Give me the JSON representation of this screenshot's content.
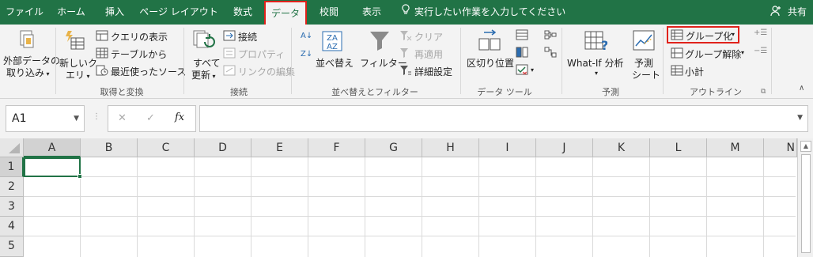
{
  "tabs": [
    "ファイル",
    "ホーム",
    "挿入",
    "ページ レイアウト",
    "数式",
    "データ",
    "校閲",
    "表示"
  ],
  "active_tab": "データ",
  "tell_me": "実行したい作業を入力してください",
  "share": "共有",
  "ribbon": {
    "external_data": {
      "l1": "外部データの",
      "l2": "取り込み"
    },
    "new_query": {
      "l1": "新しいク",
      "l2": "エリ"
    },
    "show_queries": "クエリの表示",
    "from_table": "テーブルから",
    "recent_sources": "最近使ったソース",
    "group_get_transform": "取得と変換",
    "refresh_all": {
      "l1": "すべて",
      "l2": "更新"
    },
    "connections": "接続",
    "properties": "プロパティ",
    "edit_links": "リンクの編集",
    "group_connections": "接続",
    "sort": "並べ替え",
    "filter": "フィルター",
    "clear": "クリア",
    "reapply": "再適用",
    "advanced": "詳細設定",
    "group_sort_filter": "並べ替えとフィルター",
    "text_to_columns": "区切り位置",
    "group_data_tools": "データ ツール",
    "what_if": "What-If 分析",
    "forecast_sheet": {
      "l1": "予測",
      "l2": "シート"
    },
    "group_forecast": "予測",
    "group_btn": "グループ化",
    "ungroup": "グループ解除",
    "subtotal": "小計",
    "group_outline": "アウトライン"
  },
  "formula_bar": {
    "name_box": "A1",
    "fx": "fx",
    "formula": ""
  },
  "grid": {
    "columns": [
      "A",
      "B",
      "C",
      "D",
      "E",
      "F",
      "G",
      "H",
      "I",
      "J",
      "K",
      "L",
      "M",
      "N"
    ],
    "rows": [
      "1",
      "2",
      "3",
      "4",
      "5"
    ],
    "selected_cell": "A1"
  },
  "colors": {
    "accent": "#217346",
    "highlight_border": "#e0221b"
  }
}
